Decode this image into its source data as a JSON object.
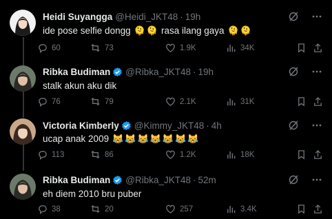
{
  "tweets": [
    {
      "name": "Heidi Suyangga",
      "handle": "@Heidi_JKT48",
      "time": "19h",
      "verified": false,
      "text": "ide pose selfie dongg",
      "text_after": "rasa ilang gaya",
      "emoji_mid": [
        "🫠",
        "🫠"
      ],
      "emoji_end": [
        "🫠",
        "🫠"
      ],
      "replies": "60",
      "reposts": "73",
      "likes": "1.9K",
      "views": "34K"
    },
    {
      "name": "Ribka Budiman",
      "handle": "@Ribka_JKT48",
      "time": "19h",
      "verified": true,
      "text": "stalk akun aku dik",
      "replies": "76",
      "reposts": "79",
      "likes": "2.1K",
      "views": "31K"
    },
    {
      "name": "Victoria Kimberly",
      "handle": "@Kimmy_JKT48",
      "time": "4h",
      "verified": true,
      "text": "ucap anak 2009",
      "emoji_end": [
        "😹",
        "😹",
        "😹",
        "😹",
        "😹",
        "😹",
        "😹"
      ],
      "replies": "113",
      "reposts": "86",
      "likes": "1.2K",
      "views": "18K"
    },
    {
      "name": "Ribka Budiman",
      "handle": "@Ribka_JKT48",
      "time": "52m",
      "verified": true,
      "text": "eh diem 2010 bru puber",
      "replies": "38",
      "reposts": "20",
      "likes": "257",
      "views": "3.4K"
    }
  ],
  "colors": {
    "bg": "#000000",
    "text": "#e7e9ea",
    "muted": "#71767b",
    "verified": "#1d9bf0",
    "divider": "#2f3336"
  }
}
